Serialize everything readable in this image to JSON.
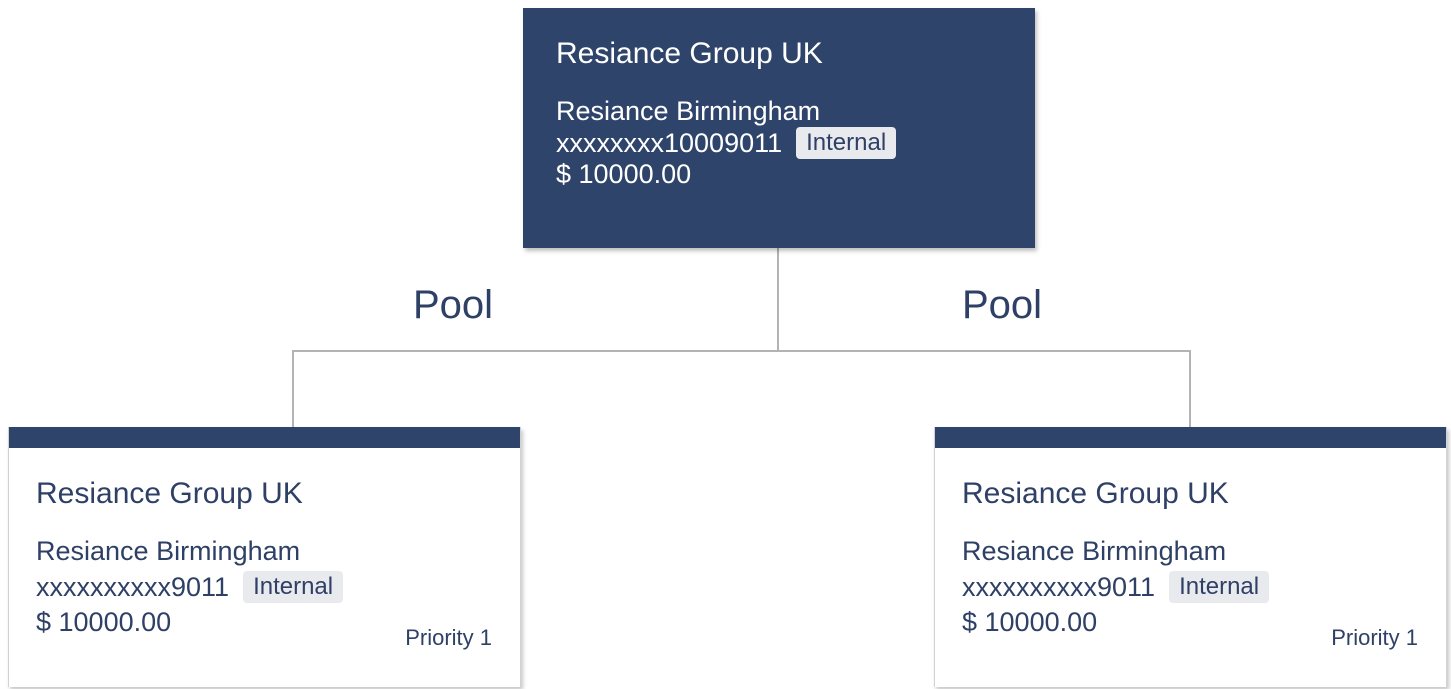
{
  "parent": {
    "org": "Resiance Group UK",
    "entity": "Resiance Birmingham",
    "account": "xxxxxxxx10009011",
    "badge": "Internal",
    "amount": "$ 10000.00"
  },
  "pool_labels": [
    "Pool",
    "Pool"
  ],
  "children": [
    {
      "org": "Resiance Group UK",
      "entity": "Resiance Birmingham",
      "account": "xxxxxxxxxx9011",
      "badge": "Internal",
      "amount": "$ 10000.00",
      "priority": "Priority 1"
    },
    {
      "org": "Resiance Group UK",
      "entity": "Resiance Birmingham",
      "account": "xxxxxxxxxx9011",
      "badge": "Internal",
      "amount": "$ 10000.00",
      "priority": "Priority 1"
    }
  ],
  "colors": {
    "card_header": "#2f446b",
    "text": "#2f4066",
    "badge_bg": "#e9eaed",
    "connector": "#b3b3b3"
  }
}
